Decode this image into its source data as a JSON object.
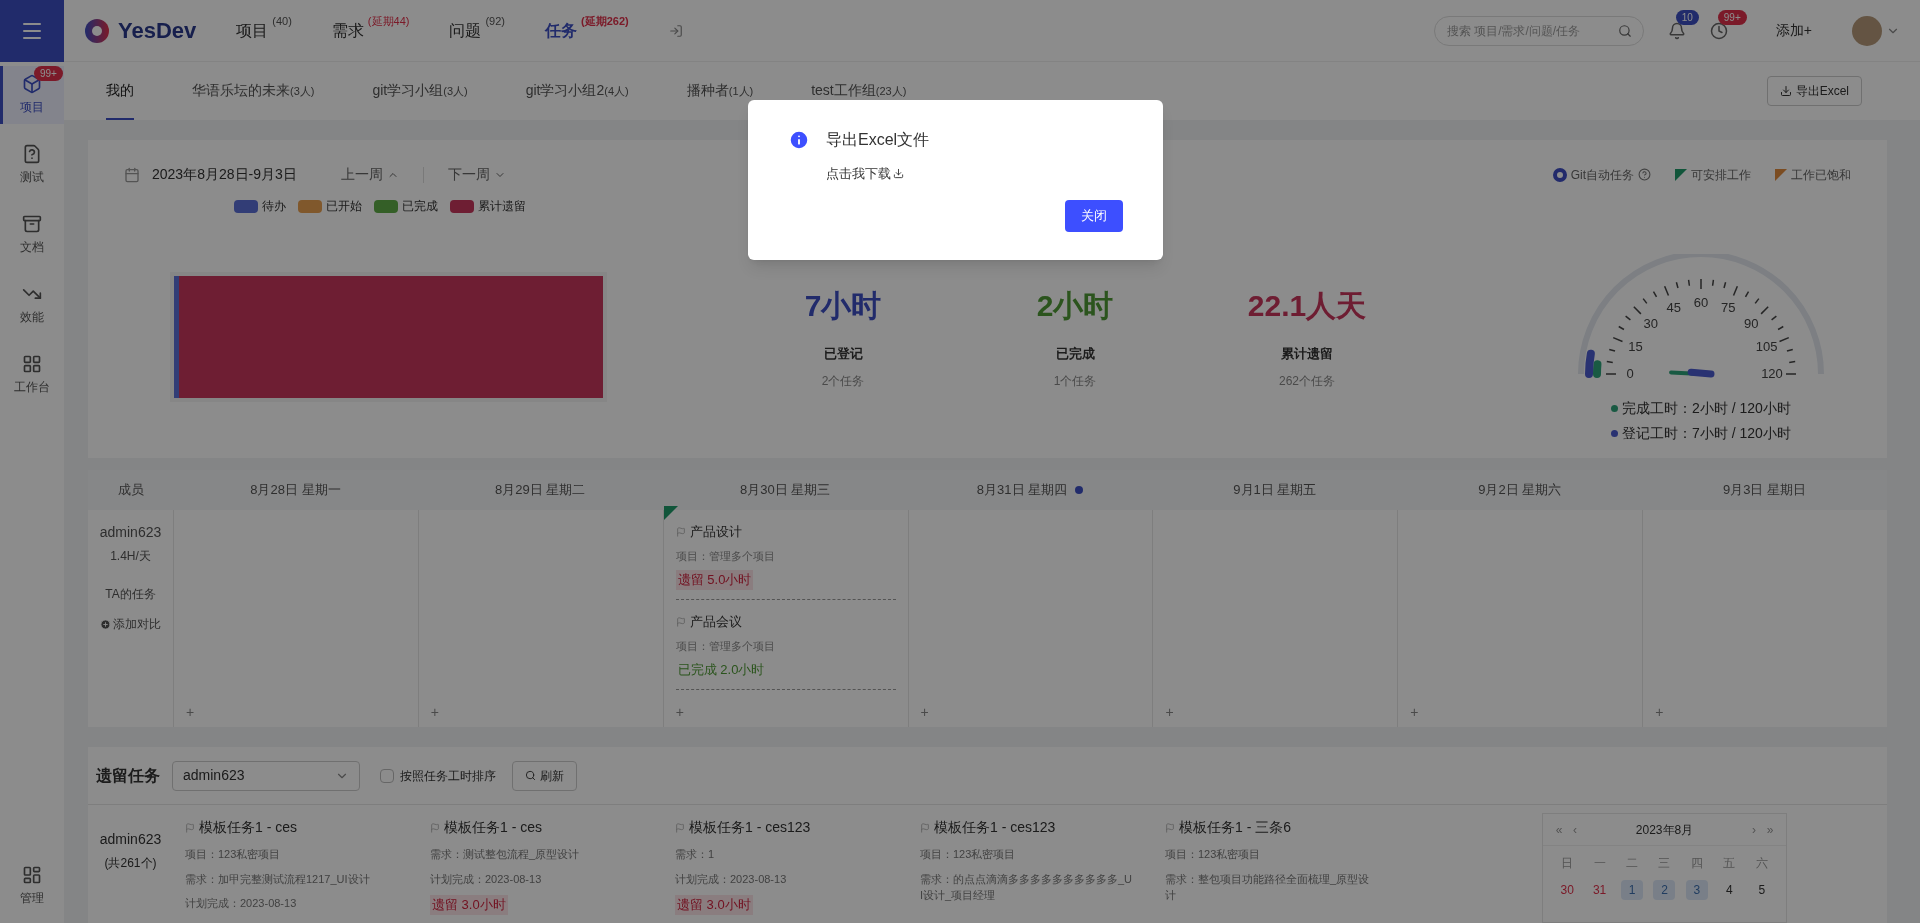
{
  "sidebar": {
    "items": [
      {
        "label": "项目",
        "kind": "box",
        "selected": true,
        "badge": "99+"
      },
      {
        "label": "测试",
        "kind": "test",
        "selected": false
      },
      {
        "label": "文档",
        "kind": "doc",
        "selected": false
      },
      {
        "label": "效能",
        "kind": "chart",
        "selected": false
      },
      {
        "label": "工作台",
        "kind": "grid",
        "selected": false
      }
    ],
    "bottom_item": {
      "label": "管理",
      "kind": "admin",
      "selected": false
    }
  },
  "topbar": {
    "logo": "YesDev",
    "nav": [
      {
        "label": "项目",
        "count": "(40)",
        "kind": "normal",
        "selected": false
      },
      {
        "label": "需求",
        "count": "(延期44)",
        "kind": "overdue",
        "selected": false
      },
      {
        "label": "问题",
        "count": "(92)",
        "kind": "normal",
        "selected": false
      },
      {
        "label": "任务",
        "count": "(延期262)",
        "kind": "overdue",
        "selected": true
      }
    ],
    "search": {
      "placeholder": "搜索 项目/需求/问题/任务"
    },
    "notifications_badge": "10",
    "reminders_badge": "99+",
    "add": "添加+"
  },
  "tabs": [
    {
      "label": "我的",
      "selected": true
    },
    {
      "label": "华语乐坛的未来",
      "count": "(3人)",
      "selected": false
    },
    {
      "label": "git学习小组",
      "count": "(3人)",
      "selected": false
    },
    {
      "label": "git学习小组2",
      "count": "(4人)",
      "selected": false
    },
    {
      "label": "播种者",
      "count": "(1人)",
      "selected": false
    },
    {
      "label": "test工作组",
      "count": "(23人)",
      "selected": false
    }
  ],
  "export_button": "导出Excel",
  "summary": {
    "date_range": "2023年8月28日-9月3日",
    "prev": "上一周",
    "next": "下一周",
    "legend": [
      {
        "label": "待办",
        "color": "#323d76",
        "level": 0.012
      },
      {
        "label": "已开始",
        "color": "#80582c"
      },
      {
        "label": "已完成",
        "color": "#345f27"
      },
      {
        "label": "累计遗留",
        "color": "#6e1e33",
        "level": 0.988
      }
    ],
    "stats": [
      {
        "value": "7小时",
        "label": "已登记",
        "sub": "2个任务",
        "kind": "logged"
      },
      {
        "value": "2小时",
        "label": "已完成",
        "sub": "1个任务",
        "kind": "done"
      },
      {
        "value": "22.1人天",
        "label": "累计遗留",
        "sub": "262个任务",
        "kind": "overdue"
      }
    ],
    "flags": [
      {
        "label": "Git自动任务",
        "kind": "git",
        "color": "#222b6c"
      },
      {
        "label": "可安排工作",
        "kind": "triangle",
        "color": "#11563b"
      },
      {
        "label": "工作已饱和",
        "kind": "triangle",
        "color": "#7b4c21"
      }
    ],
    "gauge": {
      "ticks": [
        "0",
        "15",
        "30",
        "45",
        "60",
        "75",
        "90",
        "105",
        "120"
      ],
      "readings": [
        {
          "label": "完成工时：2小时 / 120小时",
          "color": "#1a5a43",
          "level": 0.017
        },
        {
          "label": "登记工时：7小时 / 120小时",
          "color": "#293272",
          "level": 0.058
        }
      ]
    }
  },
  "calendar": {
    "member_header": "成员",
    "member": {
      "name": "admin623",
      "rate": "1.4H/天",
      "tasks_link": "TA的任务",
      "compare": "添加对比"
    },
    "days": [
      {
        "label": "8月28日 星期一",
        "today": false,
        "add": "+"
      },
      {
        "label": "8月29日 星期二",
        "today": false,
        "add": "+"
      },
      {
        "label": "8月30日 星期三",
        "today": false,
        "add": "+",
        "tasks": [
          {
            "title": "产品设计",
            "project": "项目：管理多个项目",
            "status": "遗留 5.0小时",
            "kind": "overdue",
            "flagged": true
          },
          {
            "title": "产品会议",
            "project": "项目：管理多个项目",
            "status": "已完成 2.0小时",
            "kind": "done",
            "flagged": false
          }
        ]
      },
      {
        "label": "8月31日 星期四",
        "today": true,
        "add": "+"
      },
      {
        "label": "9月1日 星期五",
        "today": false,
        "add": "+"
      },
      {
        "label": "9月2日 星期六",
        "today": false,
        "add": "+"
      },
      {
        "label": "9月3日 星期日",
        "today": false,
        "add": "+"
      }
    ]
  },
  "backlog": {
    "title": "遗留任务",
    "member_select": "admin623",
    "sort_checkbox": {
      "label": "按照任务工时排序",
      "checked": false
    },
    "refresh": "刷新",
    "member": {
      "name": "admin623",
      "count": "(共261个)"
    },
    "tasks": [
      {
        "title": "模板任务1 - ces",
        "lines": [
          "项目：123私密项目",
          "需求：加甲完整测试流程1217_UI设计",
          "计划完成：2023-08-13"
        ]
      },
      {
        "title": "模板任务1 - ces",
        "lines": [
          "需求：测试整包流程_原型设计",
          "计划完成：2023-08-13"
        ],
        "status": "遗留 3.0小时"
      },
      {
        "title": "模板任务1 - ces123",
        "lines": [
          "需求：1",
          "计划完成：2023-08-13"
        ],
        "status": "遗留 3.0小时"
      },
      {
        "title": "模板任务1 - ces123",
        "lines": [
          "项目：123私密项目",
          "需求：的点点滴滴多多多多多多多多多多_UI设计_项目经理"
        ]
      },
      {
        "title": "模板任务1 - 三条6",
        "lines": [
          "项目：123私密项目",
          "需求：整包项目功能路径全面梳理_原型设计"
        ]
      }
    ],
    "mini_calendar": {
      "title": "2023年8月",
      "nav": [
        "«",
        "‹",
        "›",
        "»"
      ],
      "weekdays": [
        "日",
        "一",
        "二",
        "三",
        "四",
        "五",
        "六"
      ],
      "dates": [
        {
          "label": "30",
          "kind": "overdue"
        },
        {
          "label": "31",
          "kind": "overdue"
        },
        {
          "label": "1",
          "kind": "task"
        },
        {
          "label": "2",
          "kind": "task"
        },
        {
          "label": "3",
          "kind": "task"
        },
        {
          "label": "4",
          "kind": "plain"
        },
        {
          "label": "5",
          "kind": "plain"
        }
      ]
    }
  },
  "modal": {
    "title": "导出Excel文件",
    "link": "点击我下载",
    "close": "关闭"
  }
}
